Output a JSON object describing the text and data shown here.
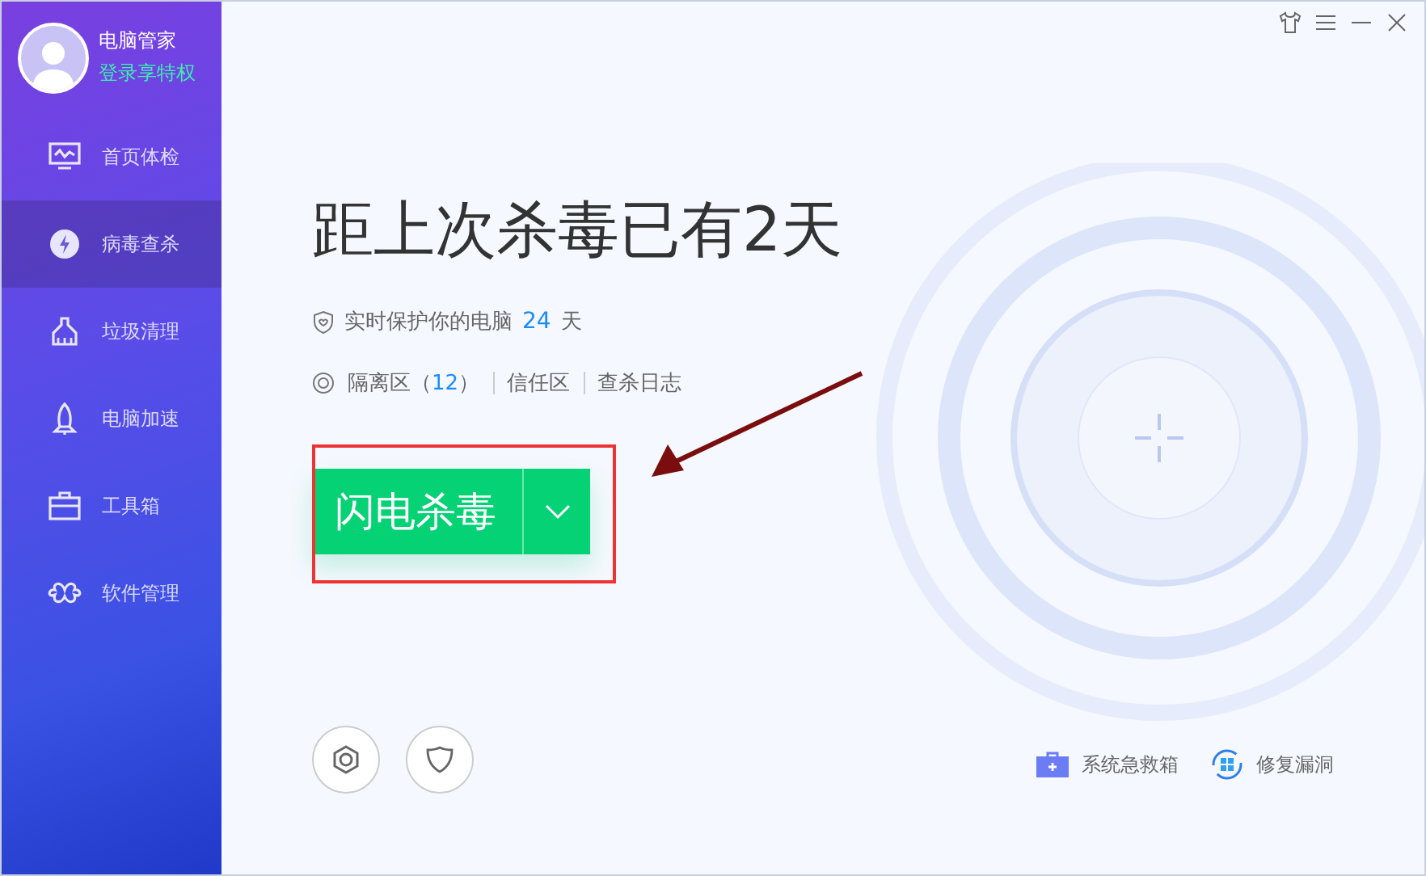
{
  "profile": {
    "name": "电脑管家",
    "login_link": "登录享特权"
  },
  "sidebar": {
    "items": [
      {
        "label": "首页体检",
        "kind": "monitor",
        "selected": false
      },
      {
        "label": "病毒查杀",
        "kind": "bolt",
        "selected": true
      },
      {
        "label": "垃圾清理",
        "kind": "broom",
        "selected": false
      },
      {
        "label": "电脑加速",
        "kind": "rocket",
        "selected": false
      },
      {
        "label": "工具箱",
        "kind": "toolbox",
        "selected": false
      },
      {
        "label": "软件管理",
        "kind": "clover",
        "selected": false
      }
    ]
  },
  "main": {
    "headline": "距上次杀毒已有2天",
    "protection": {
      "text": "实时保护你的电脑",
      "days": "24",
      "unit": "天"
    },
    "links": [
      {
        "label": "隔离区",
        "open": "（",
        "count": "12",
        "close": "）"
      },
      {
        "label": "信任区"
      },
      {
        "label": "查杀日志"
      }
    ],
    "scan_button": {
      "label": "闪电杀毒"
    },
    "bottom_tools": [
      {
        "label": "系统急救箱",
        "kind": "kit"
      },
      {
        "label": "修复漏洞",
        "kind": "windows"
      }
    ]
  }
}
